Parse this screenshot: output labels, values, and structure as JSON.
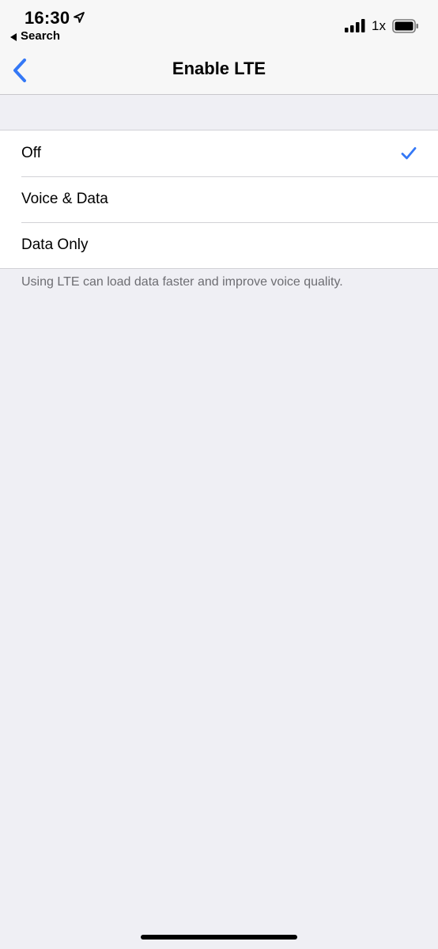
{
  "status_bar": {
    "time": "16:30",
    "back_app_label": "Search",
    "zoom": "1x"
  },
  "nav": {
    "title": "Enable LTE"
  },
  "options": [
    {
      "label": "Off",
      "selected": true
    },
    {
      "label": "Voice & Data",
      "selected": false
    },
    {
      "label": "Data Only",
      "selected": false
    }
  ],
  "footer": {
    "note": "Using LTE can load data faster and improve voice quality."
  },
  "colors": {
    "accent": "#3478f6",
    "background": "#efeff4"
  }
}
